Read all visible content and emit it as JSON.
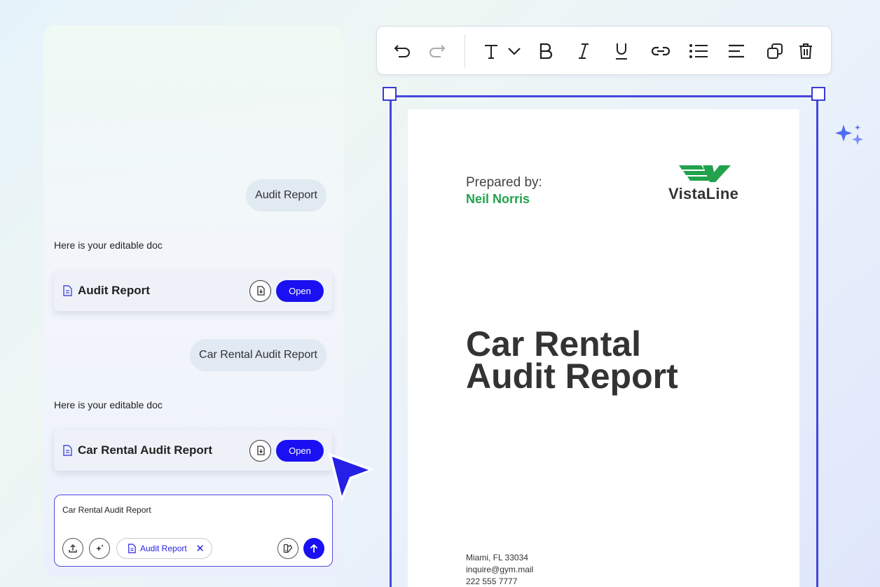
{
  "chat": {
    "messages": [
      {
        "role": "user",
        "text": "Audit Report"
      },
      {
        "role": "assistant",
        "text": "Here is your editable doc"
      },
      {
        "role": "user",
        "text": "Car Rental Audit Report"
      },
      {
        "role": "assistant",
        "text": "Here is your editable doc"
      }
    ],
    "cards": [
      {
        "title": "Audit Report",
        "open_label": "Open",
        "icon": "file-icon",
        "download_icon": "download-icon"
      },
      {
        "title": "Car Rental Audit Report",
        "open_label": "Open",
        "icon": "file-icon",
        "download_icon": "download-icon"
      }
    ],
    "composer": {
      "value": "Car Rental Audit Report",
      "chip_label": "Audit Report",
      "icons": [
        "upload-icon",
        "sparkle-icon",
        "palette-icon",
        "send-icon"
      ]
    }
  },
  "toolbar": {
    "tools": [
      "undo-icon",
      "redo-icon",
      "text-style-icon",
      "chevron-down-icon",
      "bold-icon",
      "italic-icon",
      "underline-icon",
      "link-icon",
      "bulleted-list-icon",
      "align-left-icon",
      "duplicate-icon",
      "delete-icon"
    ]
  },
  "document": {
    "prepared_label": "Prepared by:",
    "author": "Neil Norris",
    "logo_text": "VistaLine",
    "title_line1": "Car Rental",
    "title_line2": "Audit Report",
    "footer": [
      "Miami, FL 33034",
      "inquire@gym.mail",
      "222 555 7777"
    ]
  },
  "colors": {
    "accent": "#1a10f2",
    "selection": "#4546dd",
    "brand_green": "#22a24c",
    "title_text": "#333333"
  }
}
